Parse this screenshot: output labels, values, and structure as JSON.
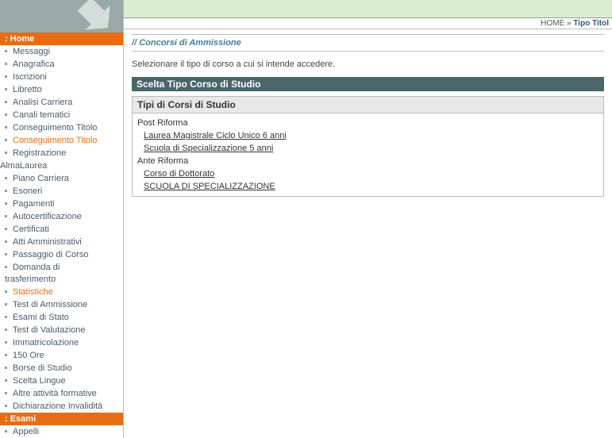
{
  "breadcrumb": {
    "home": "HOME",
    "sep": "»",
    "current": "Tipo Titol"
  },
  "sidebar": {
    "home_header": ": Home",
    "items": [
      {
        "label": "Messaggi"
      },
      {
        "label": "Anagrafica"
      },
      {
        "label": "Iscrizioni"
      },
      {
        "label": "Libretto"
      },
      {
        "label": "Analisi Carriera"
      },
      {
        "label": "Canali tematici"
      },
      {
        "label": "Conseguimento Titolo"
      },
      {
        "label": "Conseguimento Titolo",
        "active": true
      },
      {
        "label": "Registrazione"
      }
    ],
    "almalaurea_label": "AlmaLaurea",
    "items2": [
      {
        "label": "Piano Carriera"
      },
      {
        "label": "Esoneri"
      },
      {
        "label": "Pagamenti"
      },
      {
        "label": "Autocertificazione"
      },
      {
        "label": "Certificati"
      },
      {
        "label": "Atti Amministrativi"
      },
      {
        "label": "Passaggio di Corso"
      }
    ],
    "domanda_label": "Domanda di",
    "trasferimento_label": "trasferimento",
    "items3": [
      {
        "label": "Statistiche",
        "active": true
      },
      {
        "label": "Test di Ammissione"
      },
      {
        "label": "Esami di Stato"
      },
      {
        "label": "Test di Valutazione"
      },
      {
        "label": "Immatricolazione"
      },
      {
        "label": "150 Ore"
      },
      {
        "label": "Borse di Studio"
      },
      {
        "label": "Scelta Lingue"
      },
      {
        "label": "Altre attività formative"
      },
      {
        "label": "Dichiarazione Invalidità"
      }
    ],
    "esami_header": ": Esami",
    "items4": [
      {
        "label": "Appelli"
      }
    ]
  },
  "main": {
    "title_slashes": "//",
    "title": "Concorsi di Ammissione",
    "intro": "Selezionare il tipo di corso a cui si intende accedere.",
    "section_header": "Scelta Tipo Corso di Studio",
    "table_head": "Tipi di Corsi di Studio",
    "groups": [
      {
        "label": "Post Riforma",
        "links": [
          {
            "label": "Laurea Magistrale Ciclo Unico 6 anni"
          },
          {
            "label": "Scuola di Specializzazione 5 anni"
          }
        ]
      },
      {
        "label": "Ante Riforma",
        "links": [
          {
            "label": "Corso di Dottorato"
          },
          {
            "label": "SCUOLA DI SPECIALIZZAZIONE"
          }
        ]
      }
    ]
  }
}
